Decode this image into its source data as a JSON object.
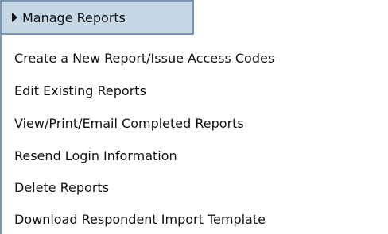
{
  "menu": {
    "header_label": "Manage Reports",
    "items": [
      {
        "label": "Create a New Report/Issue Access Codes"
      },
      {
        "label": "Edit Existing Reports"
      },
      {
        "label": "View/Print/Email Completed Reports"
      },
      {
        "label": "Resend Login Information"
      },
      {
        "label": "Delete Reports"
      },
      {
        "label": "Download Respondent Import Template"
      }
    ]
  },
  "colors": {
    "header_background": "#c6d8e6",
    "border": "#7a96b0",
    "text": "#111111"
  }
}
